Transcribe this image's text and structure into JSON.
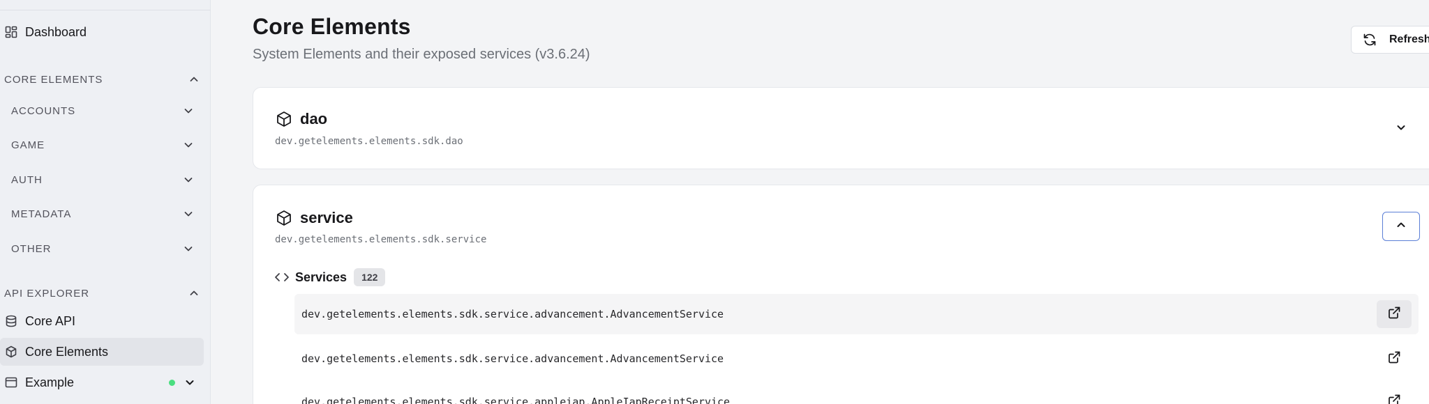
{
  "sidebar": {
    "dashboard_label": "Dashboard",
    "core_elements_heading": "CORE ELEMENTS",
    "core_items": [
      {
        "label": "ACCOUNTS"
      },
      {
        "label": "GAME"
      },
      {
        "label": "AUTH"
      },
      {
        "label": "METADATA"
      },
      {
        "label": "OTHER"
      }
    ],
    "api_explorer_heading": "API EXPLORER",
    "api_items": [
      {
        "label": "Core API"
      },
      {
        "label": "Core Elements"
      },
      {
        "label": "Example"
      }
    ],
    "status_color": "#4ade80"
  },
  "header": {
    "title": "Core Elements",
    "subtitle": "System Elements and their exposed services (v3.6.24)",
    "refresh_label": "Refresh"
  },
  "cards": [
    {
      "name": "dao",
      "package": "dev.getelements.elements.sdk.dao"
    },
    {
      "name": "service",
      "package": "dev.getelements.elements.sdk.service"
    }
  ],
  "services": {
    "label": "Services",
    "count": "122",
    "rows": [
      "dev.getelements.elements.sdk.service.advancement.AdvancementService",
      "dev.getelements.elements.sdk.service.advancement.AdvancementService",
      "dev.getelements.elements.sdk.service.appleiap.AppleIapReceiptService"
    ]
  },
  "colors": {
    "accent_border": "#5b7fd6",
    "background": "#f3f4f6"
  }
}
